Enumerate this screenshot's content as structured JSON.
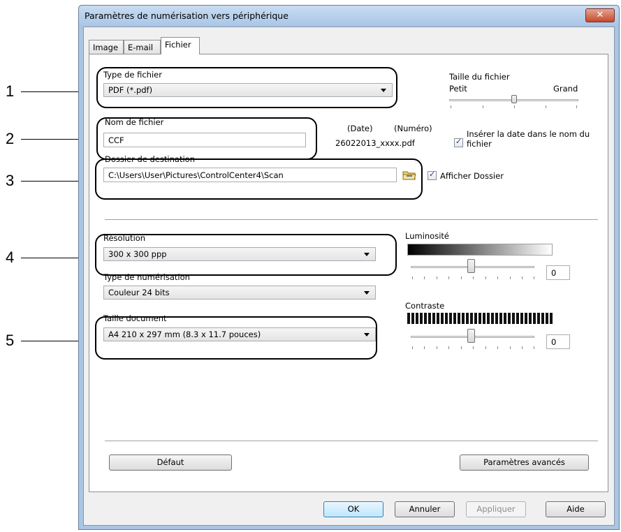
{
  "callouts": [
    "1",
    "2",
    "3",
    "4",
    "5"
  ],
  "window": {
    "title": "Paramètres de numérisation vers périphérique",
    "close_label": "✕"
  },
  "tabs": [
    {
      "label": "Image",
      "active": false
    },
    {
      "label": "E-mail",
      "active": false
    },
    {
      "label": "Fichier",
      "active": true
    }
  ],
  "file": {
    "type_label": "Type de fichier",
    "type_value": "PDF (*.pdf)",
    "size_label": "Taille du fichier",
    "size_small": "Petit",
    "size_large": "Grand",
    "size_level": 0.5,
    "name_label": "Nom de fichier",
    "name_value": "CCF",
    "date_hdr": "(Date)",
    "number_hdr": "(Numéro)",
    "sample_name": "26022013_xxxx.pdf",
    "insert_date_label": "Insérer la date dans le nom du fichier",
    "insert_date_checked": true,
    "folder_label": "Dossier de destination",
    "folder_value": "C:\\Users\\User\\Pictures\\ControlCenter4\\Scan",
    "show_folder_label": "Afficher Dossier",
    "show_folder_checked": true
  },
  "scan": {
    "resolution_label": "Résolution",
    "resolution_value": "300 x 300 ppp",
    "scan_type_label": "Type de numérisation",
    "scan_type_value": "Couleur 24 bits",
    "doc_size_label": "Taille document",
    "doc_size_value": "A4 210 x 297 mm (8.3 x 11.7 pouces)",
    "brightness_label": "Luminosité",
    "brightness_value": "0",
    "contrast_label": "Contraste",
    "contrast_value": "0"
  },
  "buttons": {
    "default": "Défaut",
    "advanced": "Paramètres avancés",
    "ok": "OK",
    "cancel": "Annuler",
    "apply": "Appliquer",
    "help": "Aide"
  },
  "colors": {
    "title_bar": "#a9c5e6",
    "close": "#c44a2c",
    "checkmark": "#1f3d8a"
  }
}
